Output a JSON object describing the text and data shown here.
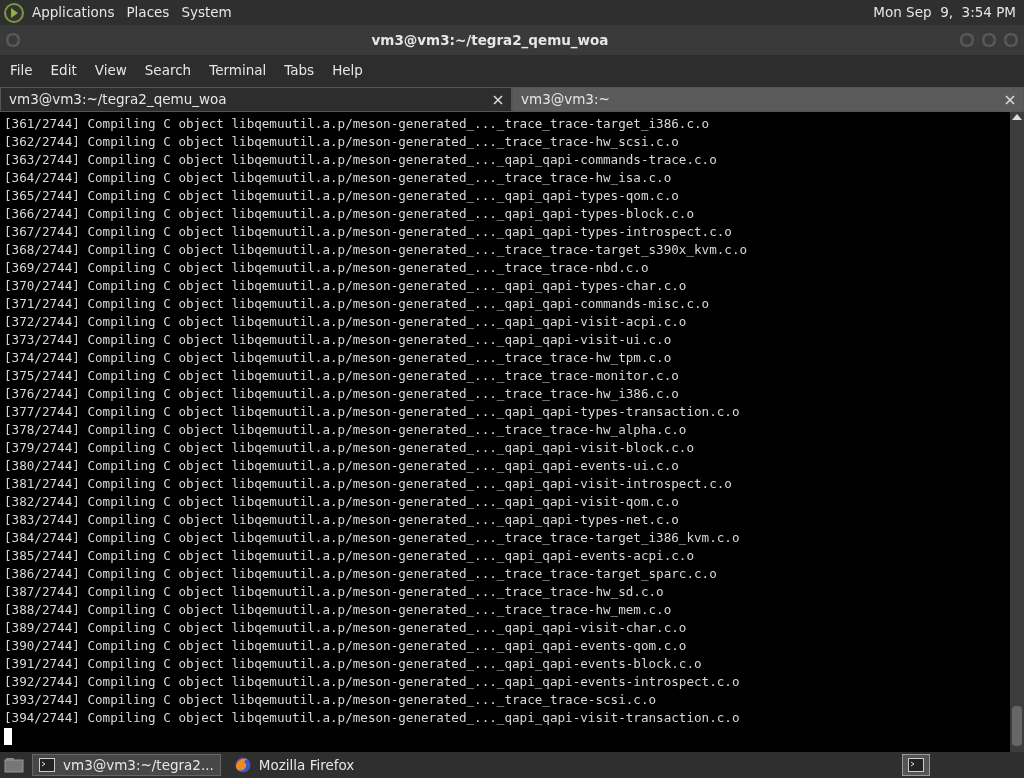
{
  "top_panel": {
    "menus": [
      "Applications",
      "Places",
      "System"
    ],
    "clock": "Mon Sep  9,  3:54 PM"
  },
  "window": {
    "title": "vm3@vm3:~/tegra2_qemu_woa"
  },
  "menu_bar": [
    "File",
    "Edit",
    "View",
    "Search",
    "Terminal",
    "Tabs",
    "Help"
  ],
  "tabs": [
    {
      "label": "vm3@vm3:~/tegra2_qemu_woa",
      "selected": true
    },
    {
      "label": "vm3@vm3:~",
      "selected": false
    }
  ],
  "terminal": {
    "lines": [
      "[361/2744] Compiling C object libqemuutil.a.p/meson-generated_..._trace_trace-target_i386.c.o",
      "[362/2744] Compiling C object libqemuutil.a.p/meson-generated_..._trace_trace-hw_scsi.c.o",
      "[363/2744] Compiling C object libqemuutil.a.p/meson-generated_..._qapi_qapi-commands-trace.c.o",
      "[364/2744] Compiling C object libqemuutil.a.p/meson-generated_..._trace_trace-hw_isa.c.o",
      "[365/2744] Compiling C object libqemuutil.a.p/meson-generated_..._qapi_qapi-types-qom.c.o",
      "[366/2744] Compiling C object libqemuutil.a.p/meson-generated_..._qapi_qapi-types-block.c.o",
      "[367/2744] Compiling C object libqemuutil.a.p/meson-generated_..._qapi_qapi-types-introspect.c.o",
      "[368/2744] Compiling C object libqemuutil.a.p/meson-generated_..._trace_trace-target_s390x_kvm.c.o",
      "[369/2744] Compiling C object libqemuutil.a.p/meson-generated_..._trace_trace-nbd.c.o",
      "[370/2744] Compiling C object libqemuutil.a.p/meson-generated_..._qapi_qapi-types-char.c.o",
      "[371/2744] Compiling C object libqemuutil.a.p/meson-generated_..._qapi_qapi-commands-misc.c.o",
      "[372/2744] Compiling C object libqemuutil.a.p/meson-generated_..._qapi_qapi-visit-acpi.c.o",
      "[373/2744] Compiling C object libqemuutil.a.p/meson-generated_..._qapi_qapi-visit-ui.c.o",
      "[374/2744] Compiling C object libqemuutil.a.p/meson-generated_..._trace_trace-hw_tpm.c.o",
      "[375/2744] Compiling C object libqemuutil.a.p/meson-generated_..._trace_trace-monitor.c.o",
      "[376/2744] Compiling C object libqemuutil.a.p/meson-generated_..._trace_trace-hw_i386.c.o",
      "[377/2744] Compiling C object libqemuutil.a.p/meson-generated_..._qapi_qapi-types-transaction.c.o",
      "[378/2744] Compiling C object libqemuutil.a.p/meson-generated_..._trace_trace-hw_alpha.c.o",
      "[379/2744] Compiling C object libqemuutil.a.p/meson-generated_..._qapi_qapi-visit-block.c.o",
      "[380/2744] Compiling C object libqemuutil.a.p/meson-generated_..._qapi_qapi-events-ui.c.o",
      "[381/2744] Compiling C object libqemuutil.a.p/meson-generated_..._qapi_qapi-visit-introspect.c.o",
      "[382/2744] Compiling C object libqemuutil.a.p/meson-generated_..._qapi_qapi-visit-qom.c.o",
      "[383/2744] Compiling C object libqemuutil.a.p/meson-generated_..._qapi_qapi-types-net.c.o",
      "[384/2744] Compiling C object libqemuutil.a.p/meson-generated_..._trace_trace-target_i386_kvm.c.o",
      "[385/2744] Compiling C object libqemuutil.a.p/meson-generated_..._qapi_qapi-events-acpi.c.o",
      "[386/2744] Compiling C object libqemuutil.a.p/meson-generated_..._trace_trace-target_sparc.c.o",
      "[387/2744] Compiling C object libqemuutil.a.p/meson-generated_..._trace_trace-hw_sd.c.o",
      "[388/2744] Compiling C object libqemuutil.a.p/meson-generated_..._trace_trace-hw_mem.c.o",
      "[389/2744] Compiling C object libqemuutil.a.p/meson-generated_..._qapi_qapi-visit-char.c.o",
      "[390/2744] Compiling C object libqemuutil.a.p/meson-generated_..._qapi_qapi-events-qom.c.o",
      "[391/2744] Compiling C object libqemuutil.a.p/meson-generated_..._qapi_qapi-events-block.c.o",
      "[392/2744] Compiling C object libqemuutil.a.p/meson-generated_..._qapi_qapi-events-introspect.c.o",
      "[393/2744] Compiling C object libqemuutil.a.p/meson-generated_..._trace_trace-scsi.c.o",
      "[394/2744] Compiling C object libqemuutil.a.p/meson-generated_..._qapi_qapi-visit-transaction.c.o"
    ]
  },
  "taskbar": {
    "tasks": [
      {
        "label": "vm3@vm3:~/tegra2...",
        "selected": true,
        "kind": "terminal"
      },
      {
        "label": "Mozilla Firefox",
        "selected": false,
        "kind": "browser"
      }
    ]
  }
}
